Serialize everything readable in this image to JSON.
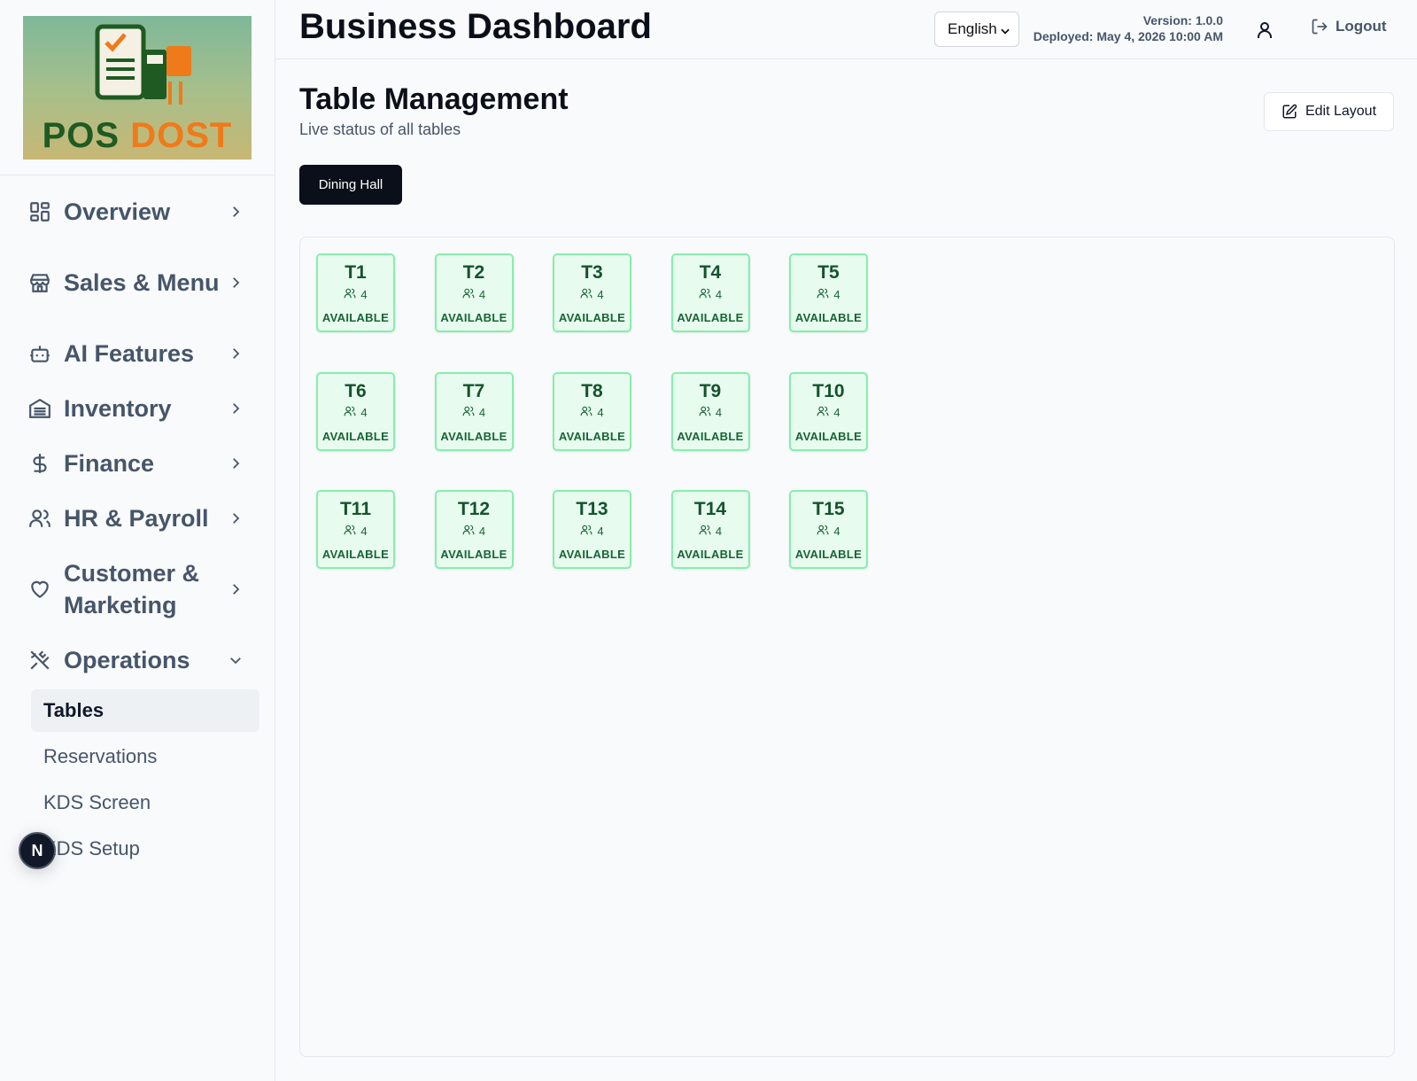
{
  "brand": {
    "logo_pos": "POS",
    "logo_dost": "DOST"
  },
  "header": {
    "title": "Business Dashboard",
    "language": "English",
    "version": "Version: 1.0.0",
    "deployed": "Deployed: May 4, 2026 10:00 AM",
    "logout_label": "Logout"
  },
  "sidebar": {
    "items": [
      {
        "label": "Overview",
        "icon": "layout-grid-icon"
      },
      {
        "label": "Sales & Menu",
        "icon": "store-icon"
      },
      {
        "label": "AI Features",
        "icon": "bot-icon"
      },
      {
        "label": "Inventory",
        "icon": "warehouse-icon"
      },
      {
        "label": "Finance",
        "icon": "dollar-icon"
      },
      {
        "label": "HR & Payroll",
        "icon": "users-icon"
      },
      {
        "label": "Customer & Marketing",
        "icon": "heart-icon"
      },
      {
        "label": "Operations",
        "icon": "utensils-crossed-icon"
      }
    ],
    "operations_sub": [
      "Tables",
      "Reservations",
      "KDS Screen",
      "KDS Setup"
    ],
    "active_sub": "Tables"
  },
  "badge": {
    "letter": "N"
  },
  "page": {
    "title": "Table Management",
    "subtitle": "Live status of all tables",
    "edit_label": "Edit Layout",
    "area_tab": "Dining Hall"
  },
  "tables": [
    {
      "name": "T1",
      "capacity": "4",
      "status": "AVAILABLE"
    },
    {
      "name": "T2",
      "capacity": "4",
      "status": "AVAILABLE"
    },
    {
      "name": "T3",
      "capacity": "4",
      "status": "AVAILABLE"
    },
    {
      "name": "T4",
      "capacity": "4",
      "status": "AVAILABLE"
    },
    {
      "name": "T5",
      "capacity": "4",
      "status": "AVAILABLE"
    },
    {
      "name": "T6",
      "capacity": "4",
      "status": "AVAILABLE"
    },
    {
      "name": "T7",
      "capacity": "4",
      "status": "AVAILABLE"
    },
    {
      "name": "T8",
      "capacity": "4",
      "status": "AVAILABLE"
    },
    {
      "name": "T9",
      "capacity": "4",
      "status": "AVAILABLE"
    },
    {
      "name": "T10",
      "capacity": "4",
      "status": "AVAILABLE"
    },
    {
      "name": "T11",
      "capacity": "4",
      "status": "AVAILABLE"
    },
    {
      "name": "T12",
      "capacity": "4",
      "status": "AVAILABLE"
    },
    {
      "name": "T13",
      "capacity": "4",
      "status": "AVAILABLE"
    },
    {
      "name": "T14",
      "capacity": "4",
      "status": "AVAILABLE"
    },
    {
      "name": "T15",
      "capacity": "4",
      "status": "AVAILABLE"
    }
  ],
  "colors": {
    "available_border": "#86efac",
    "available_bg": "#e8fbef",
    "available_text": "#166534",
    "primary": "#0b0f19"
  }
}
